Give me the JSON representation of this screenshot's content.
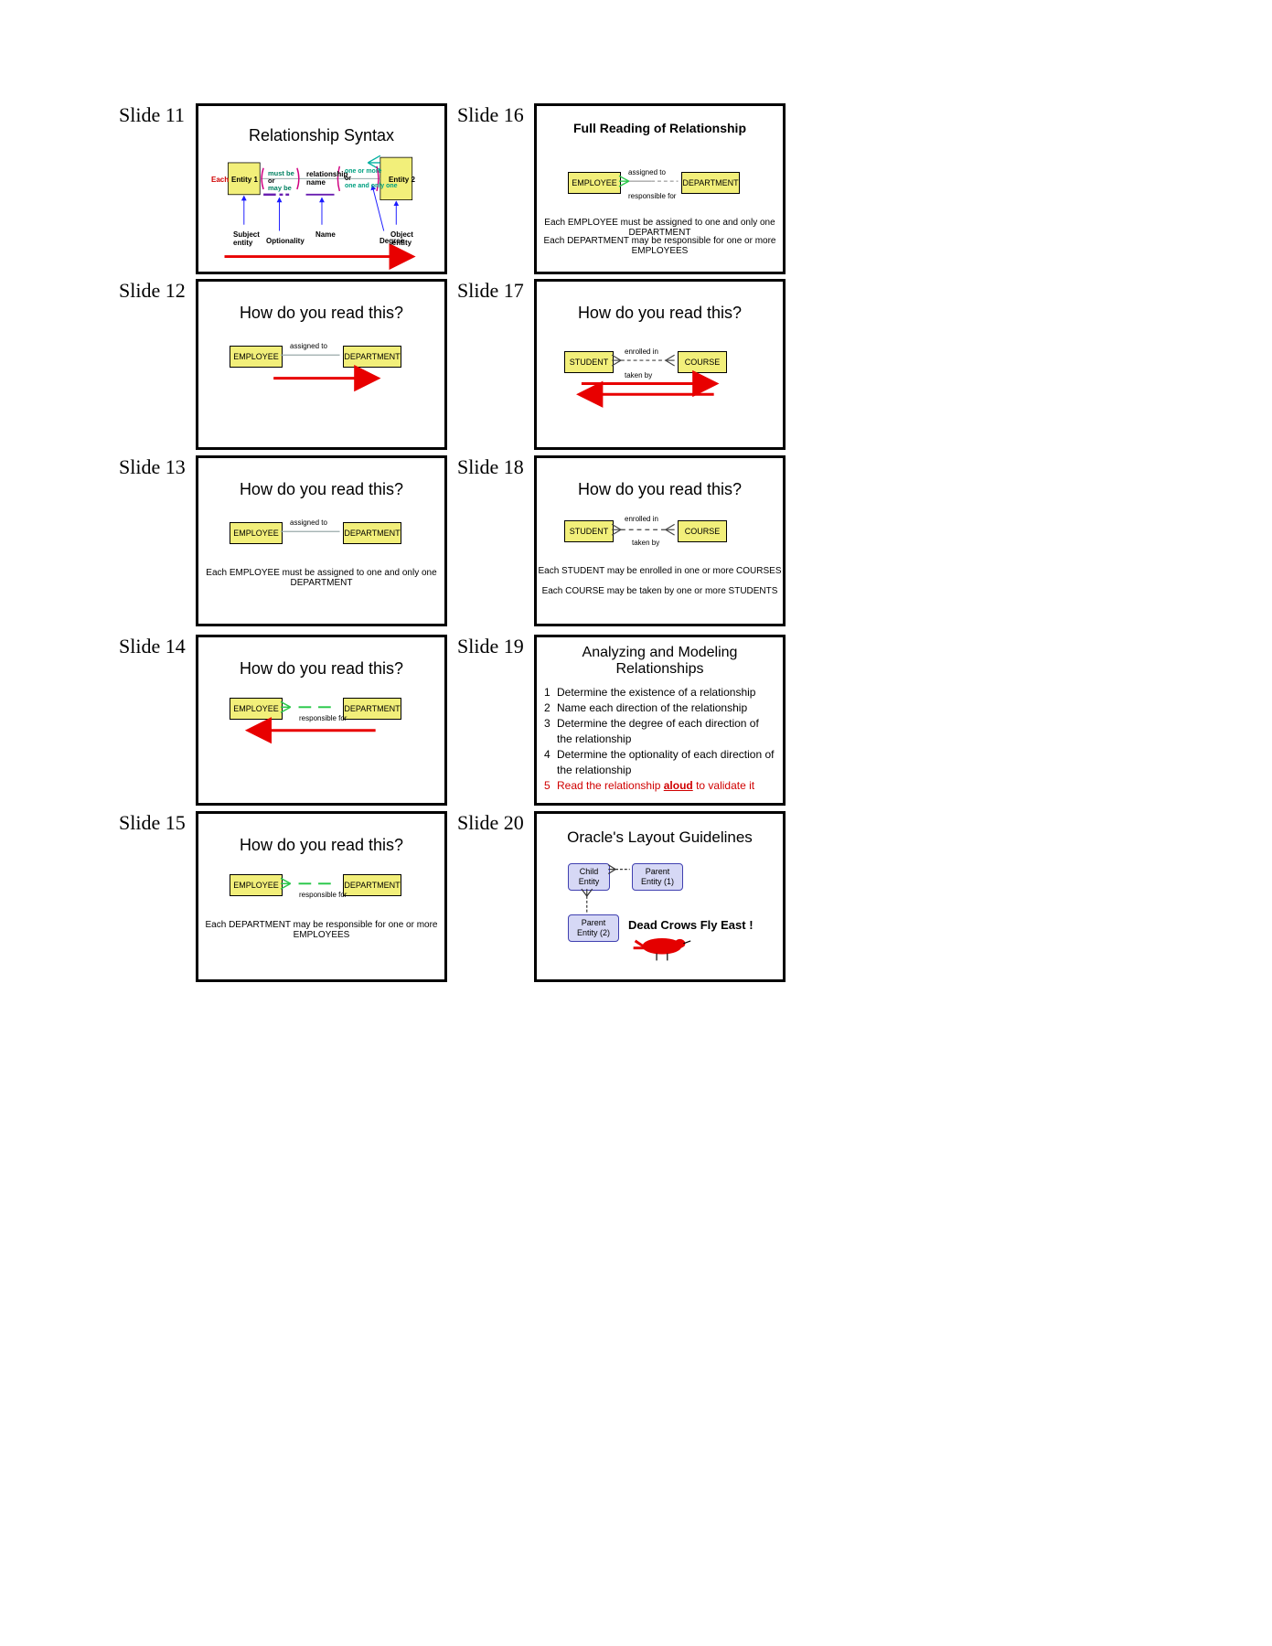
{
  "labels": {
    "s11": "Slide 11",
    "s12": "Slide 12",
    "s13": "Slide 13",
    "s14": "Slide 14",
    "s15": "Slide 15",
    "s16": "Slide 16",
    "s17": "Slide 17",
    "s18": "Slide 18",
    "s19": "Slide 19",
    "s20": "Slide 20"
  },
  "s11": {
    "title": "Relationship Syntax",
    "each": "Each",
    "entity1": "Entity 1",
    "entity2": "Entity 2",
    "mustbe": "must be",
    "or": "or",
    "maybe": "may be",
    "relname": "relationship\nname",
    "oneormore": "one or more",
    "or2": "or",
    "oneandonlyone": "one and only one",
    "subj": "Subject\nentity",
    "optionality": "Optionality",
    "name": "Name",
    "degree": "Degree",
    "obj": "Object\nentity"
  },
  "s12": {
    "title": "How do you read this?",
    "emp": "EMPLOYEE",
    "dept": "DEPARTMENT",
    "assigned": "assigned to"
  },
  "s13": {
    "title": "How do you read this?",
    "emp": "EMPLOYEE",
    "dept": "DEPARTMENT",
    "assigned": "assigned to",
    "line": "Each EMPLOYEE must be assigned to one and only one DEPARTMENT"
  },
  "s14": {
    "title": "How do you read this?",
    "emp": "EMPLOYEE",
    "dept": "DEPARTMENT",
    "resp": "responsible for"
  },
  "s15": {
    "title": "How do you read this?",
    "emp": "EMPLOYEE",
    "dept": "DEPARTMENT",
    "resp": "responsible for",
    "line": "Each DEPARTMENT may be responsible for one or more EMPLOYEES"
  },
  "s16": {
    "title": "Full Reading of Relationship",
    "emp": "EMPLOYEE",
    "dept": "DEPARTMENT",
    "assigned": "assigned to",
    "resp": "responsible for",
    "line1": "Each EMPLOYEE must be assigned to one and only one DEPARTMENT",
    "line2": "Each DEPARTMENT may be responsible for one or more EMPLOYEES"
  },
  "s17": {
    "title": "How do you read this?",
    "student": "STUDENT",
    "course": "COURSE",
    "enrolled": "enrolled in",
    "takenby": "taken by"
  },
  "s18": {
    "title": "How do you read this?",
    "student": "STUDENT",
    "course": "COURSE",
    "enrolled": "enrolled in",
    "takenby": "taken by",
    "line1": "Each STUDENT may be enrolled in one or more COURSES",
    "line2": "Each COURSE may be taken by one or more STUDENTS"
  },
  "s19": {
    "title": "Analyzing and Modeling\nRelationships",
    "n1": "1",
    "i1": "Determine the existence of a relationship",
    "n2": "2",
    "i2": "Name each direction of the relationship",
    "n3": "3",
    "i3": "Determine the degree of each direction of the relationship",
    "n4": "4",
    "i4": "Determine the optionality of each direction of the relationship",
    "n5": "5",
    "i5pre": "Read the relationship ",
    "i5u": "aloud",
    "i5post": " to validate it"
  },
  "s20": {
    "title": "Oracle's Layout Guidelines",
    "child": "Child\nEntity",
    "parent1": "Parent\nEntity (1)",
    "parent2": "Parent\nEntity (2)",
    "crow": "Dead Crows Fly East !"
  }
}
